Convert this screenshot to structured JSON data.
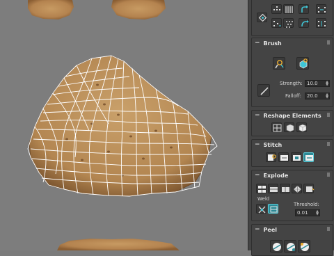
{
  "panel": {
    "brush": {
      "title": "Brush",
      "strength_label": "Strength:",
      "strength_value": "10.0",
      "falloff_label": "Falloff:",
      "falloff_value": "20.0"
    },
    "reshape": {
      "title": "Reshape Elements"
    },
    "stitch": {
      "title": "Stitch"
    },
    "explode": {
      "title": "Explode",
      "weld_label": "Weld",
      "threshold_label": "Threshold:",
      "threshold_value": "0.01"
    },
    "peel": {
      "title": "Peel"
    },
    "collapse_symbol": "−"
  },
  "colors": {
    "viewport_bg": "#7d7d7d",
    "panel_bg": "#444444",
    "accent": "#2c8a96",
    "wire": "#ffffff",
    "cookie": "#b98a55"
  },
  "icons": [
    "grab-icon",
    "relax-brush-icon",
    "paint-icon",
    "stitch-icon",
    "explode-icon",
    "weld-icon",
    "peel-icon"
  ]
}
